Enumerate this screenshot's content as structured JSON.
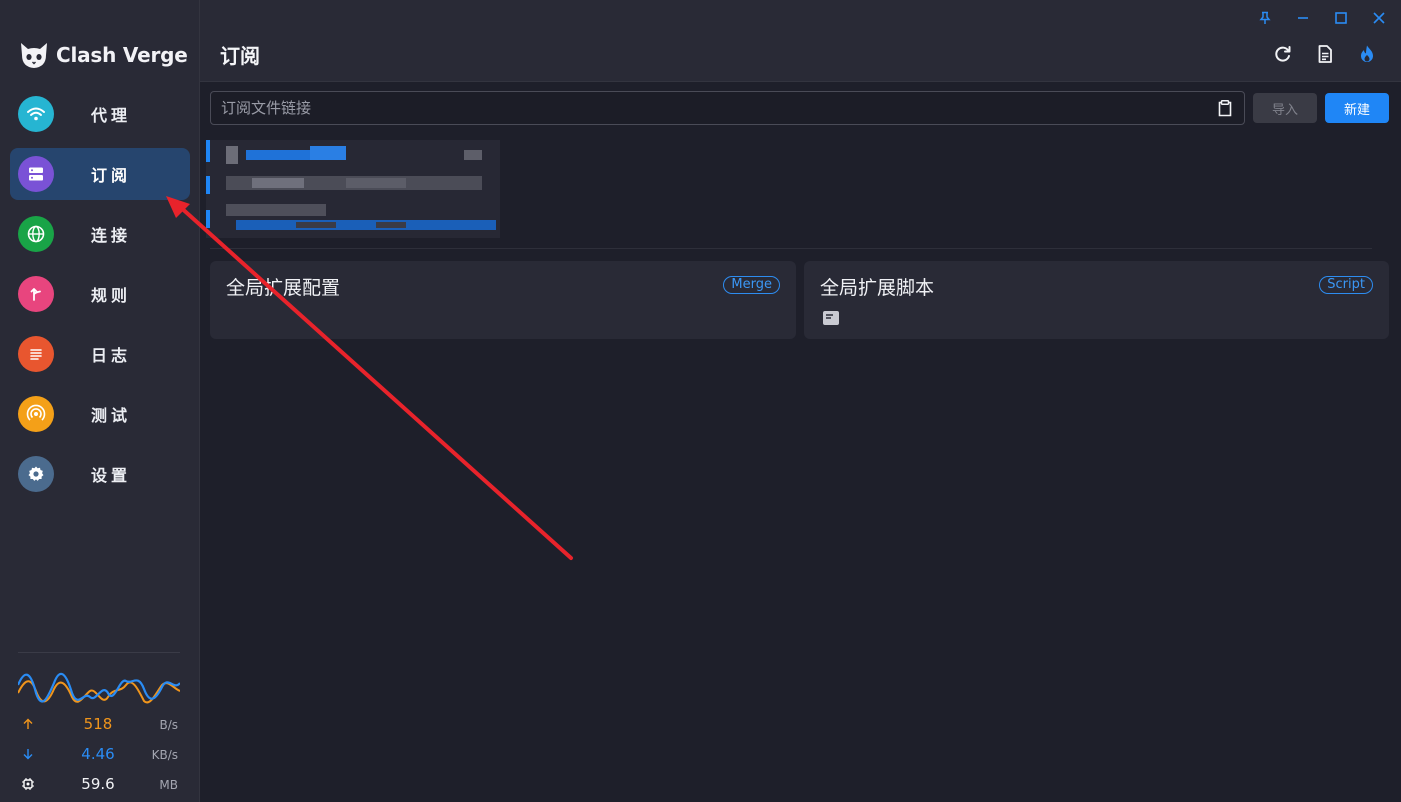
{
  "app": {
    "name": "Clash Verge"
  },
  "nav": {
    "items": [
      {
        "label": "代理",
        "icon": "wifi-icon",
        "color": "#26b5d2"
      },
      {
        "label": "订阅",
        "icon": "server-icon",
        "color": "#7a52d6"
      },
      {
        "label": "连接",
        "icon": "globe-icon",
        "color": "#19a447"
      },
      {
        "label": "规则",
        "icon": "fork-icon",
        "color": "#e8457e"
      },
      {
        "label": "日志",
        "icon": "list-icon",
        "color": "#e8562f"
      },
      {
        "label": "测试",
        "icon": "radar-icon",
        "color": "#f4a018"
      },
      {
        "label": "设置",
        "icon": "gear-icon",
        "color": "#4b6b8e"
      }
    ],
    "active_index": 1
  },
  "traffic": {
    "up": {
      "value": "518",
      "unit": "B/s",
      "color": "#f0951c"
    },
    "down": {
      "value": "4.46",
      "unit": "KB/s",
      "color": "#2a8cf4"
    },
    "memory": {
      "value": "59.6",
      "unit": "MB"
    }
  },
  "page": {
    "title": "订阅"
  },
  "import": {
    "placeholder": "订阅文件链接",
    "import_label": "导入",
    "new_label": "新建"
  },
  "extensions": [
    {
      "title": "全局扩展配置",
      "tag": "Merge"
    },
    {
      "title": "全局扩展脚本",
      "tag": "Script"
    }
  ],
  "colors": {
    "accent": "#1f86f6",
    "annotation_arrow": "#e8232b"
  }
}
